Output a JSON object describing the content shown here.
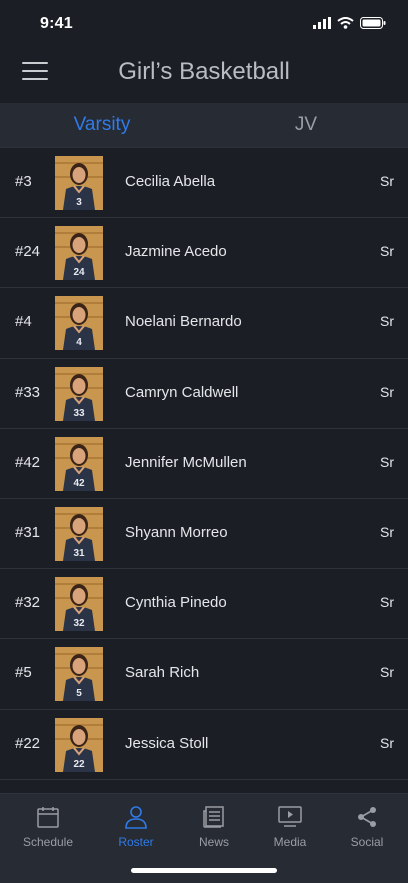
{
  "status_bar": {
    "time": "9:41"
  },
  "header": {
    "title": "Girl’s Basketball"
  },
  "tabs": [
    {
      "label": "Varsity",
      "active": true
    },
    {
      "label": "JV",
      "active": false
    }
  ],
  "roster": [
    {
      "number": "#3",
      "name": "Cecilia Abella",
      "class": "Sr",
      "jersey": "3"
    },
    {
      "number": "#24",
      "name": "Jazmine Acedo",
      "class": "Sr",
      "jersey": "24"
    },
    {
      "number": "#4",
      "name": "Noelani Bernardo",
      "class": "Sr",
      "jersey": "4"
    },
    {
      "number": "#33",
      "name": "Camryn Caldwell",
      "class": "Sr",
      "jersey": "33"
    },
    {
      "number": "#42",
      "name": "Jennifer McMullen",
      "class": "Sr",
      "jersey": "42"
    },
    {
      "number": "#31",
      "name": "Shyann Morreo",
      "class": "Sr",
      "jersey": "31"
    },
    {
      "number": "#32",
      "name": "Cynthia Pinedo",
      "class": "Sr",
      "jersey": "32"
    },
    {
      "number": "#5",
      "name": "Sarah Rich",
      "class": "Sr",
      "jersey": "5"
    },
    {
      "number": "#22",
      "name": "Jessica Stoll",
      "class": "Sr",
      "jersey": "22"
    }
  ],
  "tab_bar": [
    {
      "label": "Schedule",
      "icon": "calendar-icon",
      "active": false
    },
    {
      "label": "Roster",
      "icon": "person-icon",
      "active": true
    },
    {
      "label": "News",
      "icon": "news-icon",
      "active": false
    },
    {
      "label": "Media",
      "icon": "media-icon",
      "active": false
    },
    {
      "label": "Social",
      "icon": "share-icon",
      "active": false
    }
  ],
  "colors": {
    "accent": "#2f7be8",
    "background": "#1b1e24",
    "bar": "#272b33",
    "muted": "#9a9da3"
  }
}
